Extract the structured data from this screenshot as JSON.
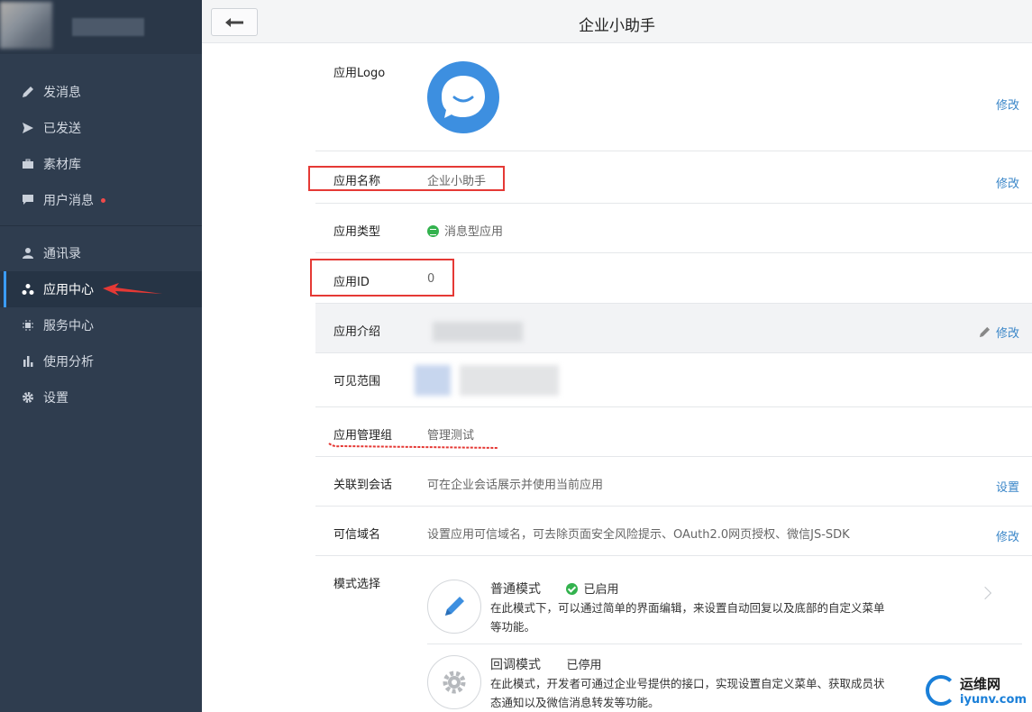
{
  "sidebar": {
    "group1": [
      {
        "label": "发消息",
        "icon": "pencil-icon"
      },
      {
        "label": "已发送",
        "icon": "send-icon"
      },
      {
        "label": "素材库",
        "icon": "briefcase-icon"
      },
      {
        "label": "用户消息",
        "icon": "chat-icon",
        "badge": "unread-dot"
      }
    ],
    "group2": [
      {
        "label": "通讯录",
        "icon": "person-icon"
      },
      {
        "label": "应用中心",
        "icon": "apps-icon",
        "active": true
      },
      {
        "label": "服务中心",
        "icon": "chip-icon"
      },
      {
        "label": "使用分析",
        "icon": "bar-chart-icon"
      },
      {
        "label": "设置",
        "icon": "gear-icon"
      }
    ]
  },
  "header": {
    "title": "企业小助手",
    "back_icon": "arrow-left-icon"
  },
  "rows": {
    "logo": {
      "label": "应用Logo",
      "action": "修改"
    },
    "name": {
      "label": "应用名称",
      "value": "企业小助手",
      "action": "修改"
    },
    "type": {
      "label": "应用类型",
      "value": "消息型应用"
    },
    "id": {
      "label": "应用ID",
      "value": "0"
    },
    "intro": {
      "label": "应用介绍",
      "action": "修改"
    },
    "scope": {
      "label": "可见范围"
    },
    "admin": {
      "label": "应用管理组",
      "value": "管理测试"
    },
    "session": {
      "label": "关联到会话",
      "value": "可在企业会话展示并使用当前应用",
      "action": "设置"
    },
    "domain": {
      "label": "可信域名",
      "value": "设置应用可信域名，可去除页面安全风险提示、OAuth2.0网页授权、微信JS-SDK",
      "action": "修改"
    },
    "mode": {
      "label": "模式选择"
    }
  },
  "modes": [
    {
      "title": "普通模式",
      "status": "已启用",
      "desc": "在此模式下，可以通过简单的界面编辑，来设置自动回复以及底部的自定义菜单等功能。",
      "icon": "pencil-icon",
      "color": "#3d8fe0"
    },
    {
      "title": "回调模式",
      "status": "已停用",
      "desc": "在此模式，开发者可通过企业号提供的接口，实现设置自定义菜单、获取成员状态通知以及微信消息转发等功能。",
      "icon": "gear-icon",
      "color": "#b6b9bd"
    }
  ],
  "watermark": {
    "cn": "运维网",
    "en": "iyunv.com"
  },
  "colors": {
    "sidebar_bg": "#2f3d4f",
    "link": "#3a86c8",
    "accent": "#3d8fe0",
    "highlight": "#e53935"
  }
}
